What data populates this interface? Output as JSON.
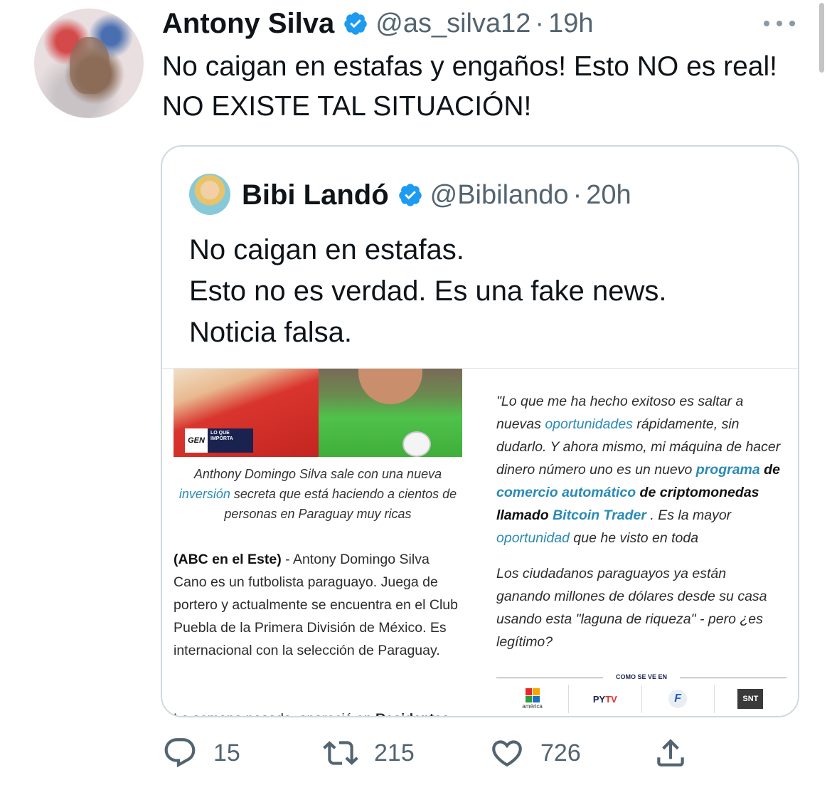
{
  "tweet": {
    "author_name": "Antony Silva",
    "handle": "@as_silva12",
    "separator": "·",
    "time": "19h",
    "text": "No caigan en estafas y engaños! Esto NO es real! NO EXISTE TAL SITUACIÓN!",
    "avatar_icon": "avatar-photo",
    "more_icon": "more-options-icon"
  },
  "quoted": {
    "author_name": "Bibi Landó",
    "handle": "@Bibilando",
    "separator": "·",
    "time": "20h",
    "text_lines": [
      "No caigan en estafas.",
      "Esto no es verdad. Es una fake news.",
      "Noticia falsa."
    ]
  },
  "article": {
    "badge_gen": "GEN",
    "badge_lqi": "LO QUE IMPORTA",
    "caption_before": "Anthony Domingo Silva sale con una nueva ",
    "caption_link": "inversión",
    "caption_after": " secreta que está haciendo a cientos de personas en Paraguay muy ricas",
    "body_lead": "(ABC en el Este)",
    "body_text": " - Antony Domingo Silva Cano es un futbolista paraguayo. Juega de portero y actualmente se encuentra en el Club Puebla de la Primera División de México. Es internacional con la selección de Paraguay.",
    "body_next_before": "La semana pasada, apareció en ",
    "body_next_bold": "Residentas",
    "quote_1": "\"Lo que me ha hecho exitoso es saltar a nuevas ",
    "quote_link_1": "oportunidades",
    "quote_2": " rápidamente, sin dudarlo. Y ahora mismo, mi máquina de hacer dinero número uno es un nuevo ",
    "quote_link_2": "programa",
    "quote_3": " de ",
    "quote_link_3": "comercio automático",
    "quote_4": " de criptomonedas llamado ",
    "quote_link_4": "Bitcoin Trader",
    "quote_5": " . Es la mayor ",
    "quote_link_5": "oportunidad",
    "quote_6": " que he visto en toda",
    "para_2": "Los ciudadanos paraguayos ya están ganando millones de dólares desde su casa usando esta \"laguna de riqueza\" - pero ¿es legítimo?",
    "seen_on": "COMO SE VE EN",
    "logos": {
      "america": "américa",
      "pytv_a": "PY",
      "pytv_b": "TV",
      "f": "F",
      "snt": "SNT"
    }
  },
  "actions": {
    "replies": "15",
    "retweets": "215",
    "likes": "726"
  },
  "colors": {
    "verified": "#1d9bf0",
    "secondary_text": "#536471",
    "link": "#2a8ab6"
  }
}
